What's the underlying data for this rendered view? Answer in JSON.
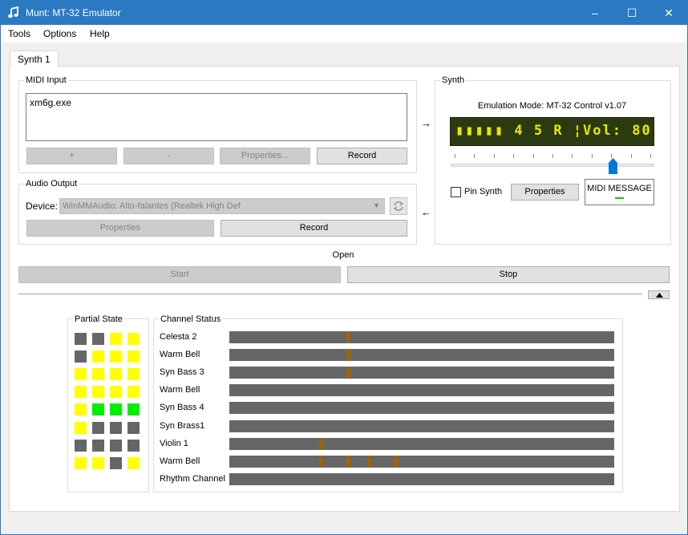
{
  "window": {
    "title": "Munt: MT-32 Emulator",
    "minimize": "–",
    "maximize": "☐",
    "close": "✕"
  },
  "menu": [
    "Tools",
    "Options",
    "Help"
  ],
  "tab": {
    "label": "Synth 1"
  },
  "midi_input": {
    "title": "MIDI Input",
    "list": [
      "xm6g.exe"
    ],
    "add_label": "+",
    "remove_label": "-",
    "properties_label": "Properties...",
    "record_label": "Record"
  },
  "arrows": {
    "right": "→",
    "left": "←"
  },
  "audio_output": {
    "title": "Audio Output",
    "device_label": "Device:",
    "device_value": "WinMMAudio: Alto-falantes (Realtek High Def",
    "properties_label": "Properties",
    "record_label": "Record"
  },
  "synth": {
    "title": "Synth",
    "emulation_mode": "Emulation Mode: MT-32 Control v1.07",
    "lcd_text": "▮▮▮▮▮ 4 5 R ¦Vol: 80",
    "volume_fraction": 0.81,
    "pin_label": "Pin Synth",
    "pin_checked": false,
    "properties_label": "Properties",
    "midi_message_label": "MIDI MESSAGE",
    "lcd_color": "#e8e800",
    "lcd_bg": "#2c3a12"
  },
  "open_label": "Open",
  "start_label": "Start",
  "stop_label": "Stop",
  "collapse_icon": "up-triangle-icon",
  "partial_state": {
    "title": "Partial State",
    "colors": {
      "off": "#666666",
      "on": "#ffff00",
      "active": "#00ee00"
    },
    "grid": [
      [
        "off",
        "off",
        "on",
        "on"
      ],
      [
        "off",
        "on",
        "on",
        "on"
      ],
      [
        "on",
        "on",
        "on",
        "on"
      ],
      [
        "on",
        "on",
        "on",
        "on"
      ],
      [
        "on",
        "active",
        "active",
        "active"
      ],
      [
        "on",
        "off",
        "off",
        "off"
      ],
      [
        "off",
        "off",
        "off",
        "off"
      ],
      [
        "on",
        "on",
        "off",
        "on"
      ]
    ]
  },
  "channel_status": {
    "title": "Channel Status",
    "channels": [
      {
        "name": "Celesta 2",
        "marks": [
          0.305
        ]
      },
      {
        "name": "Warm Bell",
        "marks": [
          0.305
        ]
      },
      {
        "name": "Syn Bass 3",
        "marks": [
          0.305
        ]
      },
      {
        "name": "Warm Bell",
        "marks": []
      },
      {
        "name": "Syn Bass 4",
        "marks": []
      },
      {
        "name": "Syn Brass1",
        "marks": []
      },
      {
        "name": "Violin 1",
        "marks": [
          0.233
        ]
      },
      {
        "name": "Warm Bell",
        "marks": [
          0.233,
          0.305,
          0.358,
          0.428
        ]
      },
      {
        "name": "Rhythm Channel",
        "marks": []
      }
    ]
  }
}
